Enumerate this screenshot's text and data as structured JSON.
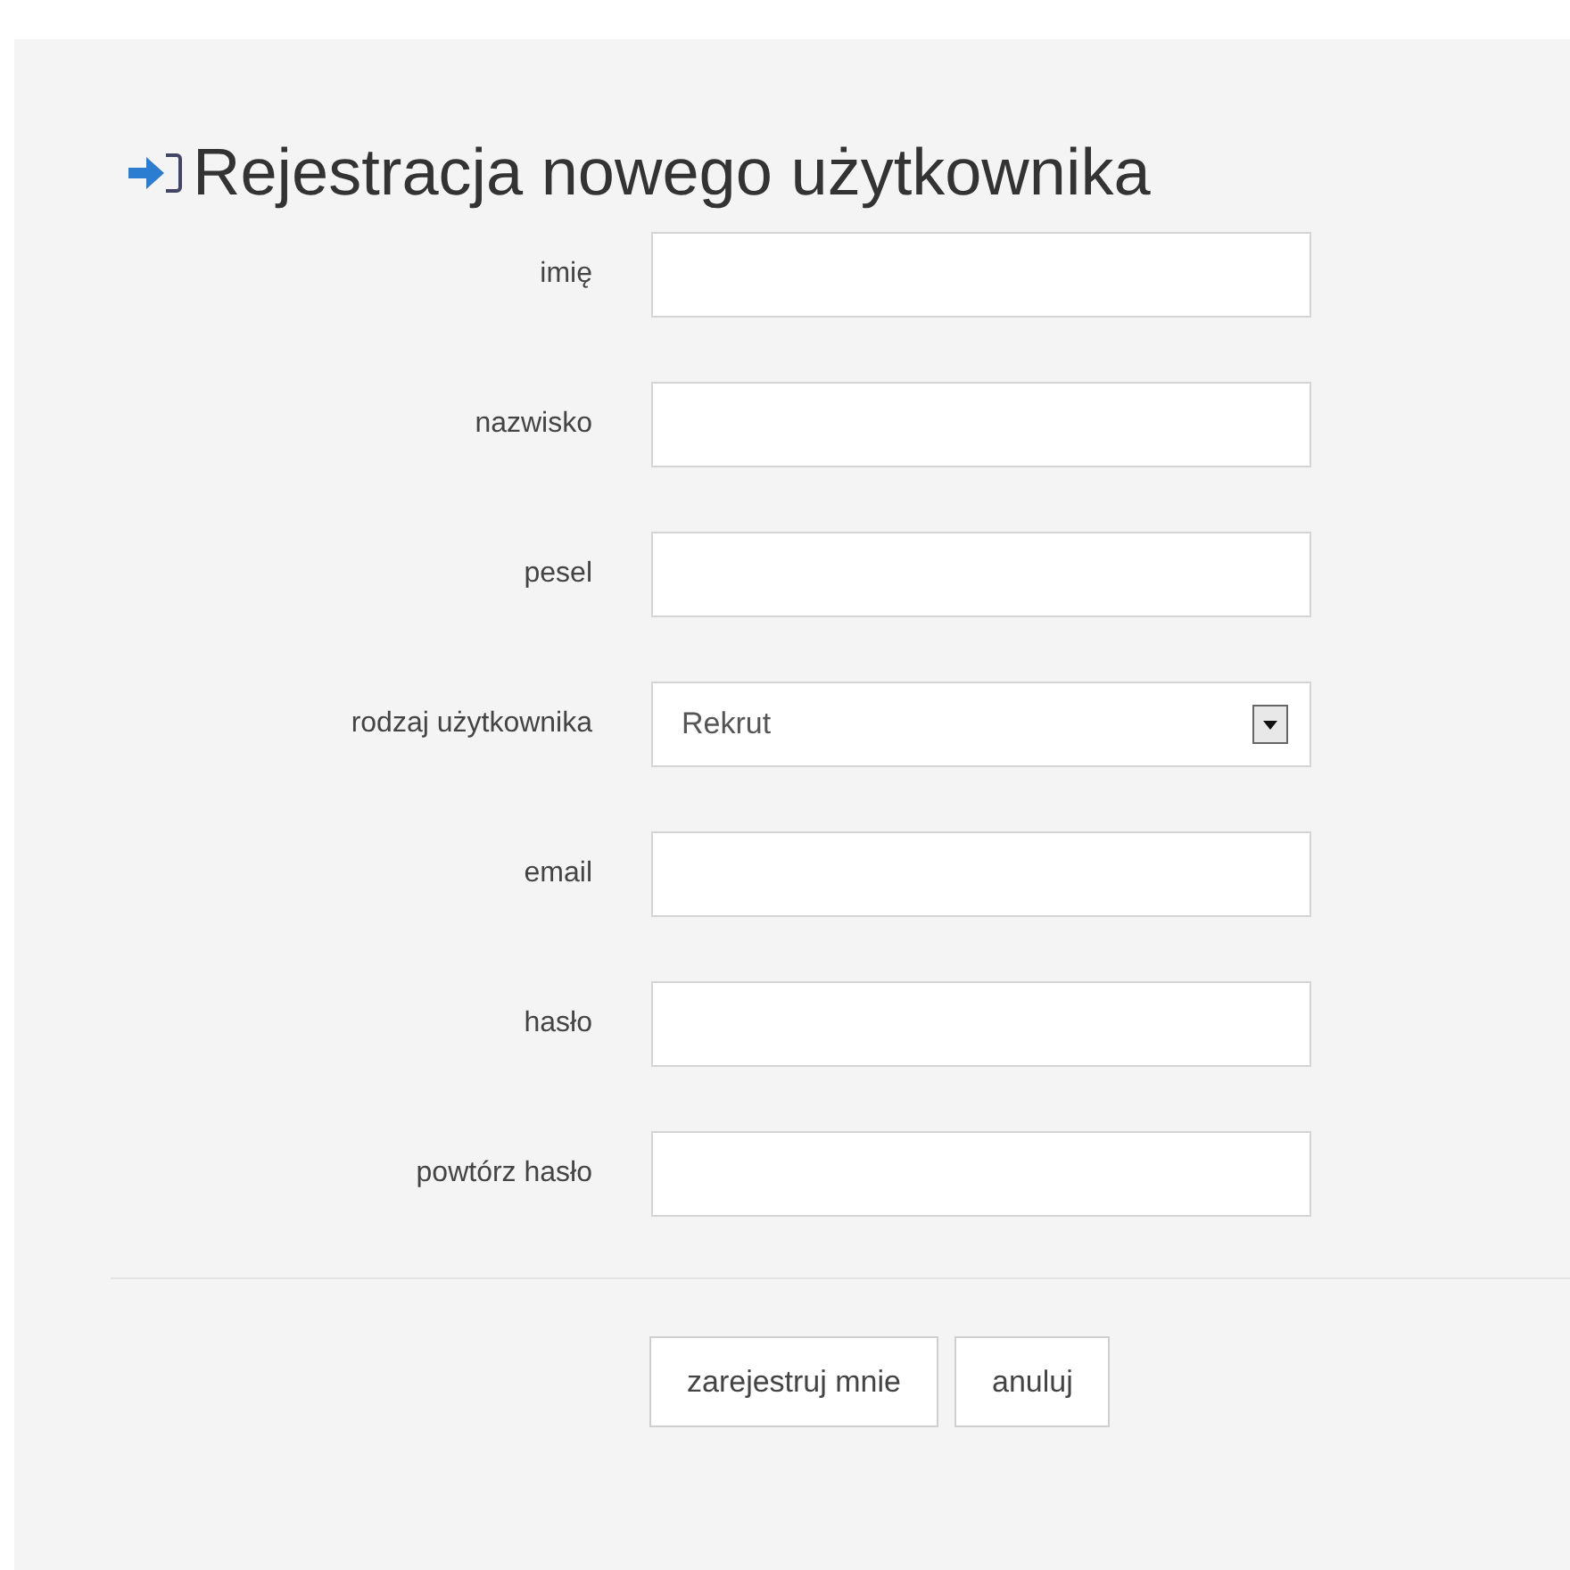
{
  "title": "Rejestracja nowego użytkownika",
  "fields": [
    {
      "kind": "text",
      "label": "imię"
    },
    {
      "kind": "text",
      "label": "nazwisko"
    },
    {
      "kind": "text",
      "label": "pesel"
    },
    {
      "kind": "select",
      "label": "rodzaj użytkownika",
      "value": "Rekrut"
    },
    {
      "kind": "text",
      "label": "email"
    },
    {
      "kind": "text",
      "label": "hasło"
    },
    {
      "kind": "text",
      "label": "powtórz hasło"
    }
  ],
  "buttons": [
    "zarejestruj mnie",
    "anuluj"
  ]
}
